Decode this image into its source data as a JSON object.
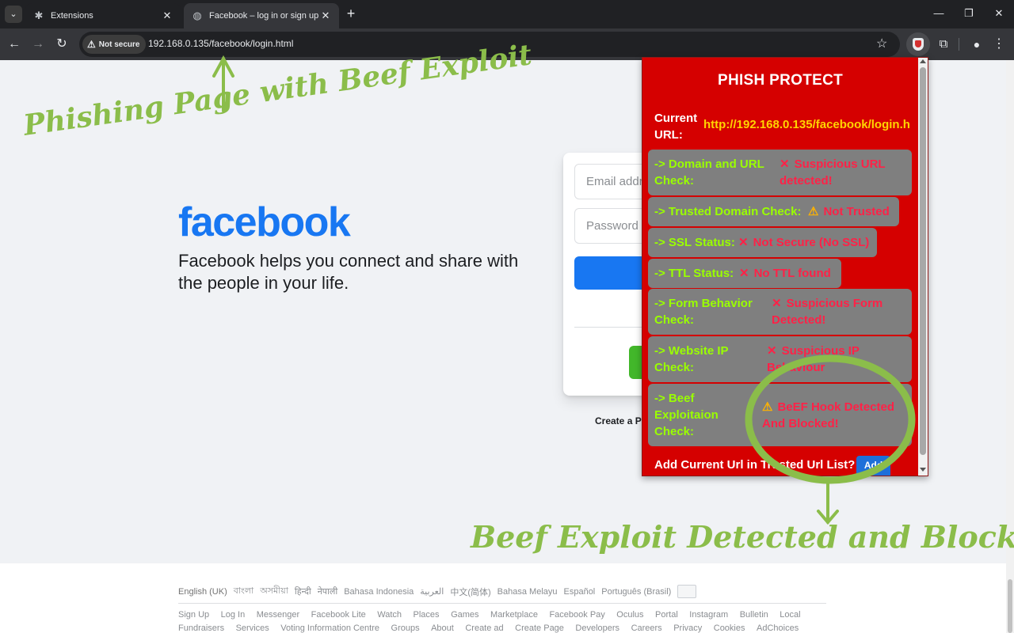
{
  "browser": {
    "tabs": [
      {
        "title": "Extensions",
        "icon": "puzzle-icon",
        "active": false
      },
      {
        "title": "Facebook – log in or sign up",
        "icon": "globe-icon",
        "active": true
      }
    ],
    "security_chip": "Not secure",
    "url": "192.168.0.135/facebook/login.html"
  },
  "facebook": {
    "logo": "facebook",
    "tagline": "Facebook helps you connect and share with the people in your life.",
    "email_placeholder": "Email address or phone number",
    "password_placeholder": "Password",
    "create_page_text": "Create a Page",
    "languages": [
      "English (UK)",
      "বাংলা",
      "অসমীয়া",
      "हिन्दी",
      "नेपाली",
      "Bahasa Indonesia",
      "العربية",
      "中文(简体)",
      "Bahasa Melayu",
      "Español",
      "Português (Brasil)"
    ],
    "footer_links_row1": [
      "Sign Up",
      "Log In",
      "Messenger",
      "Facebook Lite",
      "Watch",
      "Places",
      "Games",
      "Marketplace",
      "Facebook Pay",
      "Oculus",
      "Portal",
      "Instagram",
      "Bulletin",
      "Local"
    ],
    "footer_links_row2": [
      "Fundraisers",
      "Services",
      "Voting Information Centre",
      "Groups",
      "About",
      "Create ad",
      "Create Page",
      "Developers",
      "Careers",
      "Privacy",
      "Cookies",
      "AdChoices"
    ]
  },
  "extension": {
    "title": "PHISH PROTECT",
    "current_url_label": "Current URL:",
    "current_url": "http://192.168.0.135/facebook/login.h",
    "checks": [
      {
        "label": "-> Domain and URL Check:",
        "icon": "cross",
        "result": "Suspicious URL detected!"
      },
      {
        "label": "-> Trusted Domain Check:",
        "icon": "warning",
        "result": "Not Trusted"
      },
      {
        "label": "-> SSL Status:",
        "icon": "cross",
        "result": "Not Secure (No SSL)"
      },
      {
        "label": "-> TTL Status:",
        "icon": "cross",
        "result": "No TTL found"
      },
      {
        "label": "-> Form Behavior Check:",
        "icon": "cross",
        "result": "Suspicious Form Detected!"
      },
      {
        "label": "-> Website IP Check:",
        "icon": "cross",
        "result": "Suspicious IP Behaviour"
      },
      {
        "label": "-> Beef Exploitaion Check:",
        "icon": "warning",
        "result": "BeEF Hook Detected And Blocked!"
      }
    ],
    "add_prompt": "Add Current Url in Trusted Url List?",
    "add_button": "Add"
  },
  "annotations": {
    "top": "Phishing Page with Beef Exploit",
    "bottom": "Beef Exploit Detected and Blocked",
    "color": "#8bbd4a"
  },
  "colors": {
    "popup_bg": "#d50000",
    "check_label": "#9aff00",
    "check_result": "#ff2147",
    "url_value": "#ffd400",
    "fb_blue": "#1877f2"
  }
}
